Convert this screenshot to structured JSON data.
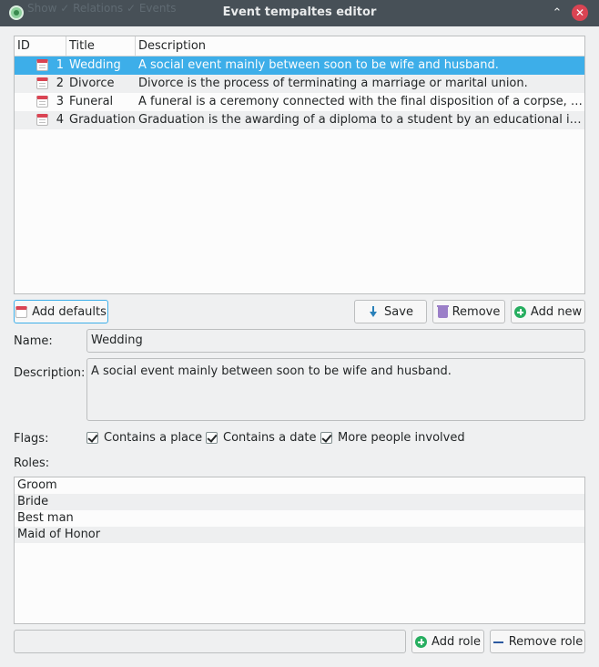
{
  "window": {
    "title": "Event tempaltes editor",
    "background_menu": "Show   ✓ Relations   ✓ Events"
  },
  "templates": {
    "headers": {
      "id": "ID",
      "title": "Title",
      "description": "Description"
    },
    "rows": [
      {
        "id": "1",
        "title": "Wedding",
        "description": "A social event mainly between soon to be wife and husband.",
        "selected": true
      },
      {
        "id": "2",
        "title": "Divorce",
        "description": "Divorce is the process of terminating a marriage or marital union."
      },
      {
        "id": "3",
        "title": "Funeral",
        "description": "A funeral is a ceremony connected with the final disposition of a corpse, such ..."
      },
      {
        "id": "4",
        "title": "Graduation",
        "description": "Graduation is the awarding of a diploma to a student by an educational institu..."
      }
    ]
  },
  "buttons": {
    "add_defaults": "Add defaults",
    "save": "Save",
    "remove": "Remove",
    "add_new": "Add new",
    "add_role": "Add role",
    "remove_role": "Remove role"
  },
  "form": {
    "name_label": "Name:",
    "name_value": "Wedding",
    "description_label": "Description:",
    "description_value": "A social event mainly between soon to be wife and husband.",
    "flags_label": "Flags:",
    "flags": [
      {
        "label": "Contains a place",
        "checked": true
      },
      {
        "label": "Contains a date",
        "checked": true
      },
      {
        "label": "More people involved",
        "checked": true
      }
    ],
    "roles_label": "Roles:",
    "roles": [
      "Groom",
      "Bride",
      "Best man",
      "Maid of Honor"
    ],
    "role_input_value": ""
  },
  "colors": {
    "selection": "#3daee9",
    "titlebar": "#475057",
    "close": "#da4453"
  }
}
